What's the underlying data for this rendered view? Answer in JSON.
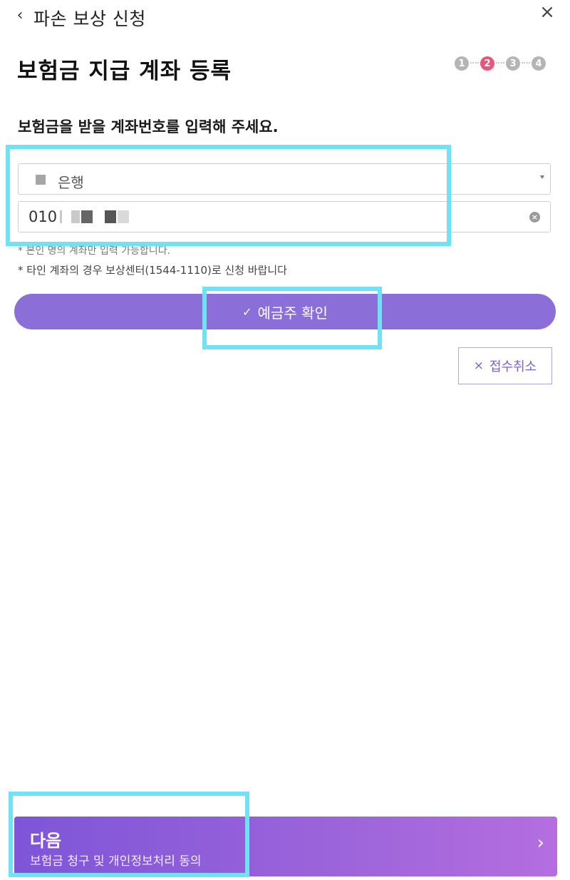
{
  "header": {
    "back_glyph": "‹",
    "title": "파손 보상 신청",
    "close_glyph": "×"
  },
  "page": {
    "title": "보험금 지급 계좌 등록"
  },
  "steps": [
    "1",
    "2",
    "3",
    "4"
  ],
  "form": {
    "instruction": "보험금을 받을 계좌번호를 입력해 주세요.",
    "bank_value": "은행",
    "account_value": "010",
    "clear_glyph": "×"
  },
  "notes": {
    "note1": "* 본인 명의 계좌만 입력 가능합니다.",
    "note2": "* 타인 계좌의 경우 보상센터(1544-1110)로 신청 바랍니다"
  },
  "buttons": {
    "confirm_glyph": "✓",
    "confirm_label": "예금주 확인",
    "cancel_glyph": "×",
    "cancel_label": "접수취소"
  },
  "next": {
    "title": "다음",
    "subtitle": "보험금 청구 및 개인정보처리 동의",
    "chevron_glyph": "›"
  },
  "colors": {
    "primary": "#8c6ed9",
    "active_step": "#e9567b",
    "highlight": "#6fe3f5"
  }
}
